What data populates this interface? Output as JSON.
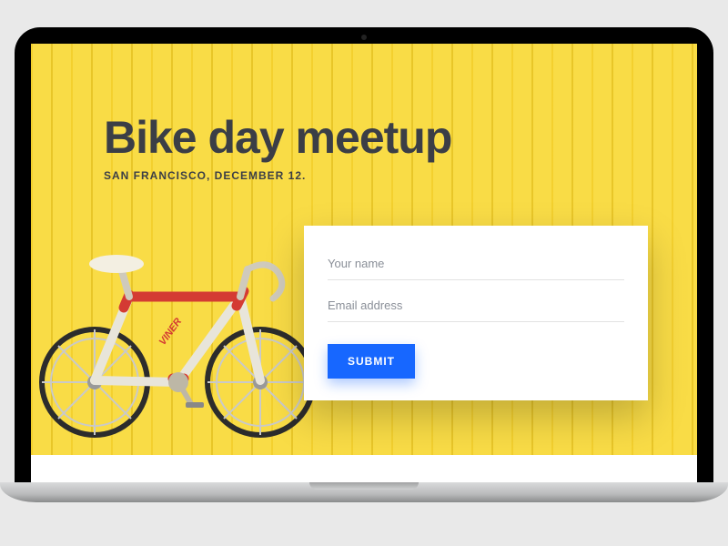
{
  "hero": {
    "title": "Bike day meetup",
    "subtitle": "SAN FRANCISCO, DECEMBER 12."
  },
  "form": {
    "name_placeholder": "Your name",
    "email_placeholder": "Email address",
    "submit_label": "SUBMIT"
  },
  "colors": {
    "accent": "#1767ff",
    "hero_bg": "#f7d93e",
    "text_dark": "#3b3e46"
  }
}
